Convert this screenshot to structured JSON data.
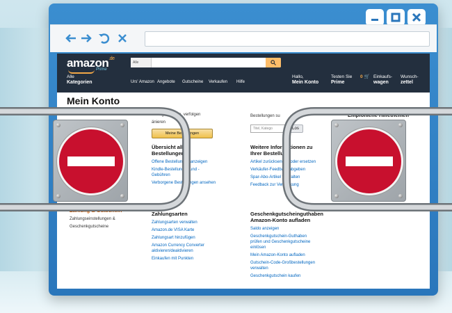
{
  "window": {
    "controls": [
      "minimize-icon",
      "maximize-icon",
      "close-icon"
    ],
    "nav_icons": [
      "back-arrow-icon",
      "forward-arrow-icon",
      "reload-icon",
      "stop-icon"
    ]
  },
  "header": {
    "logo": "amazon",
    "logo_tld": ".de",
    "logo_sub": "Prime",
    "search_category": "Alle",
    "all_categories_line1": "Alle",
    "all_categories_line2": "Kategorien",
    "nav": [
      "Urs' Amazon",
      "Angebote",
      "Gutscheine",
      "Verkaufen",
      "Hilfe"
    ],
    "account_greeting": "Hallo,",
    "account_label": "Mein Konto",
    "prime_line1": "Testen Sie",
    "prime_line2": "Prime",
    "cart_count": "0",
    "cart_line1": "Einkaufs-",
    "cart_line2": "wagen",
    "wishlist_line1": "Wunsch-",
    "wishlist_line2": "zettel"
  },
  "page": {
    "title": "Mein Konto",
    "col1": {
      "intro_line1": "tellung ansehen, verfolgen",
      "intro_line2": "änieren",
      "button": "Meine Bestellungen",
      "heading_line1": "Übersicht aller",
      "heading_line2": "Bestellungen",
      "links": [
        "Offene Bestellungen anzeigen",
        "Kindle-Bestellungen und -",
        "Gebühren",
        "Verborgene Bestellungen ansehen"
      ]
    },
    "col2": {
      "intro": "Bestellungen su",
      "search_placeholder": "Titel, Katego",
      "search_button": "Los",
      "heading_line1": "Weitere Informationen zu",
      "heading_line2": "Ihrer Bestellung",
      "links": [
        "Artikel zurücksenden oder ersetzen",
        "Verkäufer-Feedback abgeben",
        "Spar-Abo-Artikel verwalten",
        "Feedback zur Verpackung"
      ]
    },
    "col3": {
      "heading": "Empfohlene Hilfethemen"
    },
    "payment": {
      "heading": "Zahlungsarten",
      "links": [
        "Zahlungsarten verwalten",
        "Amazon.de VISA Karte",
        "Zahlungsart hinzufügen",
        "Amazon Currency Converter",
        "aktivieren/deaktivieren",
        "Einkaufen mit Punkten"
      ]
    },
    "left": {
      "heading": "Zahlung & Gutschein",
      "lines": [
        "Zahlungseinstellungen &",
        "Geschenkgutscheine"
      ]
    },
    "giftcards": {
      "heading_line1": "Geschenkgutscheinguthaben",
      "heading_line2": "Amazon-Konto aufladen",
      "links": [
        "Saldo anzeigen",
        "Geschenkgutschein-Guthaben",
        "prüfen und Geschenkgutscheine",
        "einlösen",
        "Mein Amazon-Konto aufladen",
        "Gutschein-Code-Großbestellungen",
        "verwalten",
        "Geschenkgutschein kaufen"
      ]
    }
  },
  "colors": {
    "window": "#2a76bb",
    "header": "#232f3e",
    "sign": "#c8102e",
    "link": "#0066c0"
  }
}
